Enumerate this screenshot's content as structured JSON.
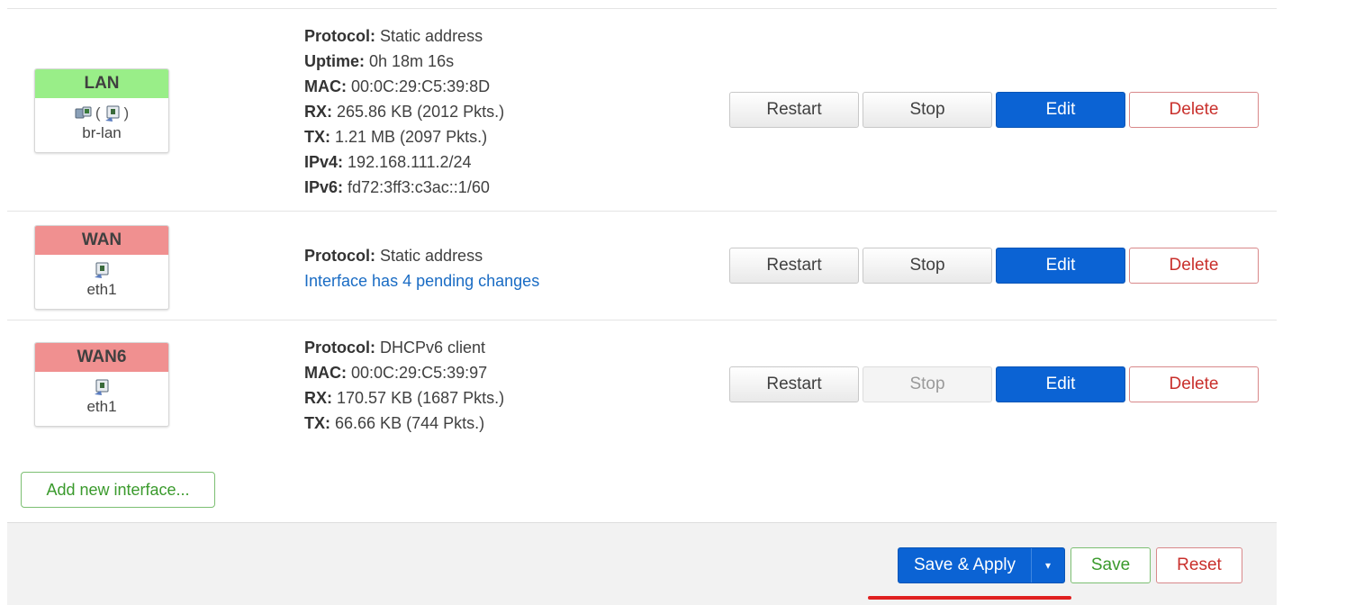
{
  "interfaces": [
    {
      "name": "LAN",
      "color": "#99ee88",
      "device": "br-lan",
      "icons": [
        "network-bridge-icon",
        "ethernet-port-icon"
      ],
      "details": [
        {
          "label": "Protocol:",
          "value": "Static address"
        },
        {
          "label": "Uptime:",
          "value": "0h 18m 16s"
        },
        {
          "label": "MAC:",
          "value": "00:0C:29:C5:39:8D"
        },
        {
          "label": "RX:",
          "value": "265.86 KB (2012 Pkts.)"
        },
        {
          "label": "TX:",
          "value": "1.21 MB (2097 Pkts.)"
        },
        {
          "label": "IPv4:",
          "value": "192.168.111.2/24"
        },
        {
          "label": "IPv6:",
          "value": "fd72:3ff3:c3ac::1/60"
        }
      ]
    },
    {
      "name": "WAN",
      "color": "#f09090",
      "device": "eth1",
      "icons": [
        "ethernet-port-icon"
      ],
      "details": [
        {
          "label": "Protocol:",
          "value": "Static address"
        }
      ],
      "pending": "Interface has 4 pending changes"
    },
    {
      "name": "WAN6",
      "color": "#f09090",
      "device": "eth1",
      "icons": [
        "ethernet-port-icon"
      ],
      "details": [
        {
          "label": "Protocol:",
          "value": "DHCPv6 client"
        },
        {
          "label": "MAC:",
          "value": "00:0C:29:C5:39:97"
        },
        {
          "label": "RX:",
          "value": "170.57 KB (1687 Pkts.)"
        },
        {
          "label": "TX:",
          "value": "66.66 KB (744 Pkts.)"
        }
      ]
    }
  ],
  "row_buttons": {
    "restart": "Restart",
    "stop": "Stop",
    "edit": "Edit",
    "delete": "Delete"
  },
  "wan6_stop_disabled": true,
  "add_interface_label": "Add new interface...",
  "footer": {
    "save_apply": "Save & Apply",
    "dropdown_caret": "▾",
    "save": "Save",
    "reset": "Reset"
  },
  "colors": {
    "primary": "#0b63d4",
    "positive": "#3a9a2c",
    "negative": "#c9302c",
    "highlight_underline": "#e02020"
  }
}
